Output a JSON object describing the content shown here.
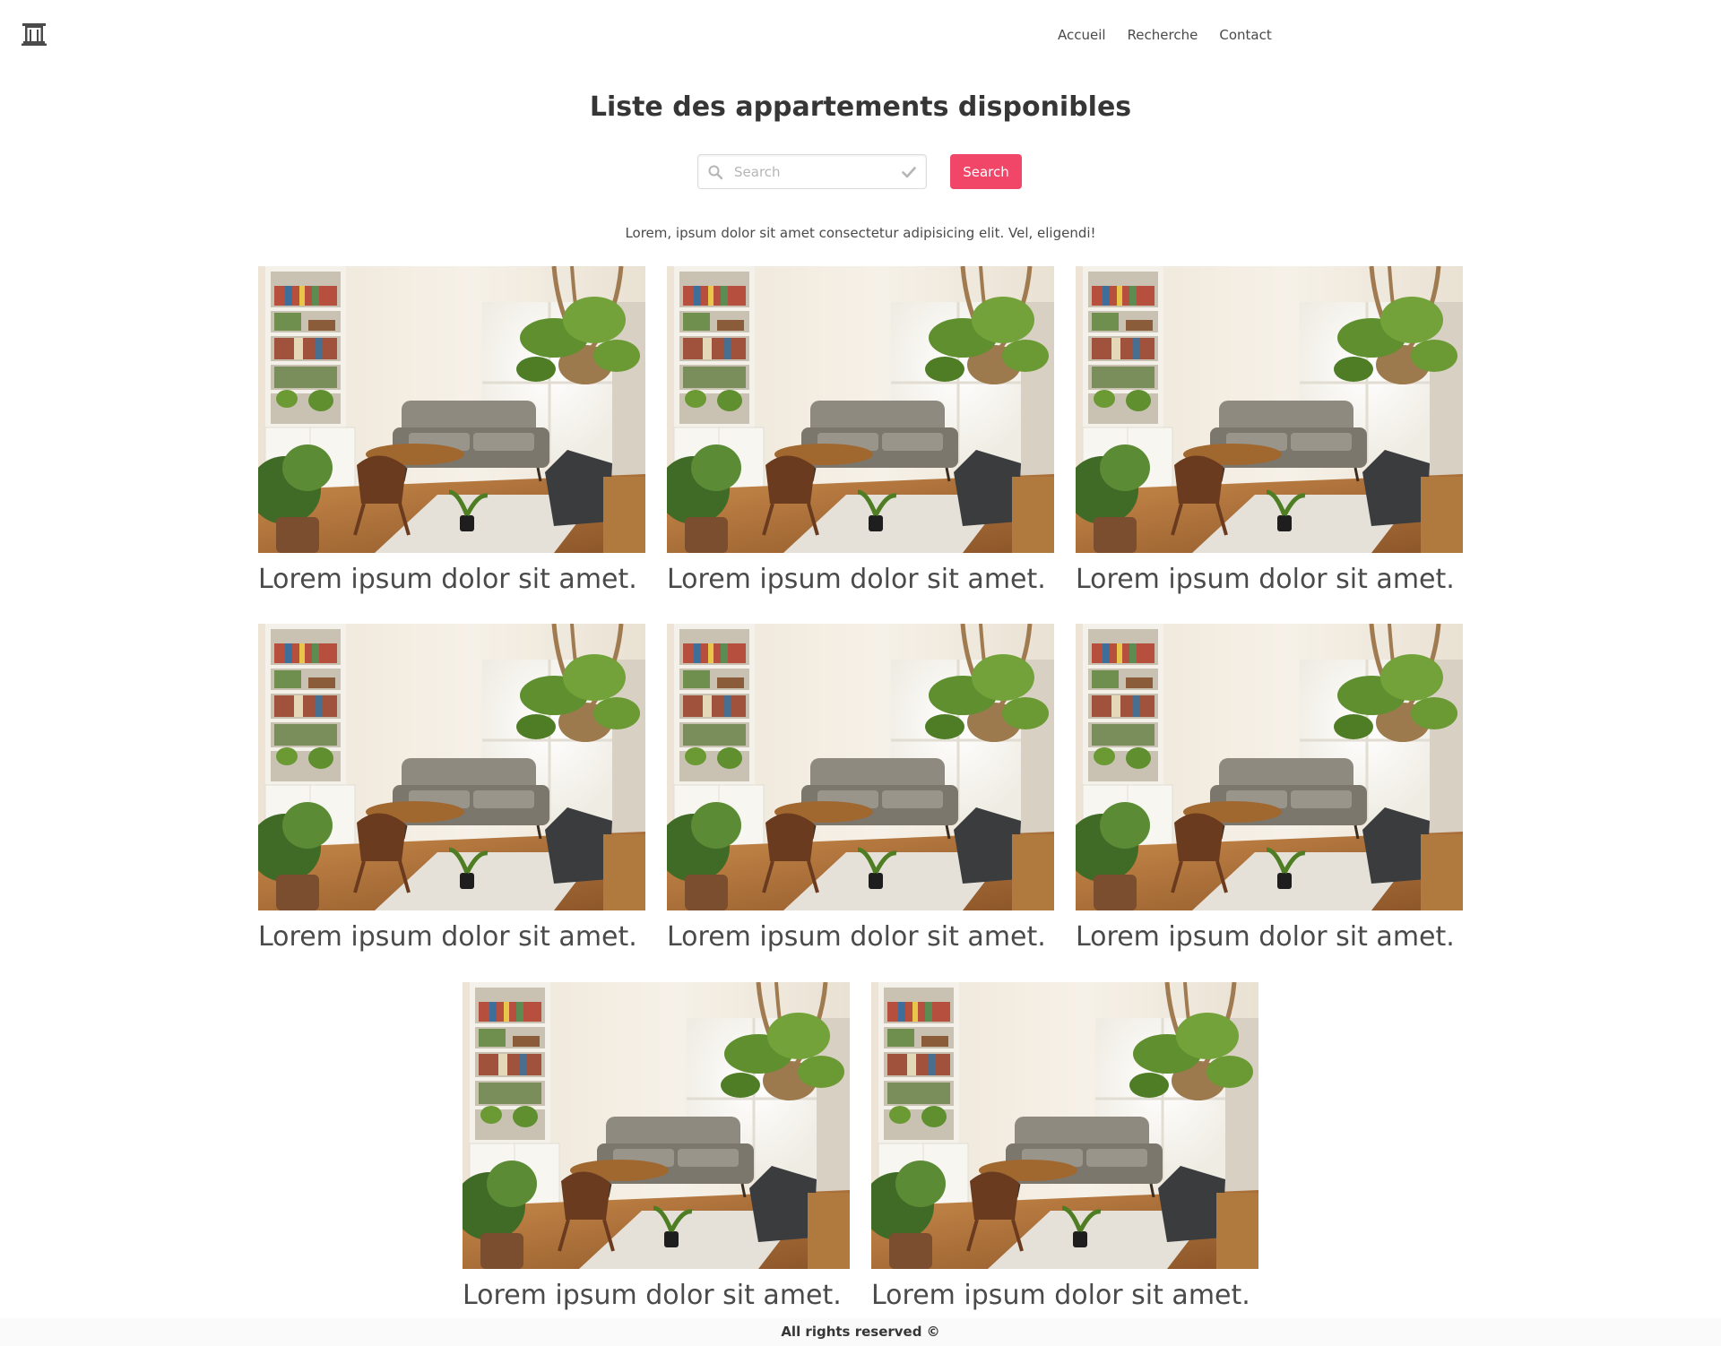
{
  "nav": {
    "brand_icon": "building-icon",
    "links": [
      {
        "label": "Accueil"
      },
      {
        "label": "Recherche"
      },
      {
        "label": "Contact"
      }
    ]
  },
  "page": {
    "title": "Liste des appartements disponibles",
    "intro": "Lorem, ipsum dolor sit amet consectetur adipisicing elit. Vel, eligendi!"
  },
  "search": {
    "placeholder": "Search",
    "value": "",
    "button_label": "Search",
    "left_icon": "search-icon",
    "right_icon": "check-icon"
  },
  "listings": [
    {
      "caption": "Lorem ipsum dolor sit amet.",
      "image": "living-room-photo"
    },
    {
      "caption": "Lorem ipsum dolor sit amet.",
      "image": "living-room-photo"
    },
    {
      "caption": "Lorem ipsum dolor sit amet.",
      "image": "living-room-photo"
    },
    {
      "caption": "Lorem ipsum dolor sit amet.",
      "image": "living-room-photo"
    },
    {
      "caption": "Lorem ipsum dolor sit amet.",
      "image": "living-room-photo"
    },
    {
      "caption": "Lorem ipsum dolor sit amet.",
      "image": "living-room-photo"
    },
    {
      "caption": "Lorem ipsum dolor sit amet.",
      "image": "living-room-photo"
    },
    {
      "caption": "Lorem ipsum dolor sit amet.",
      "image": "living-room-photo"
    }
  ],
  "footer": {
    "text": "All rights reserved ©"
  },
  "colors": {
    "accent": "#f14668",
    "text": "#363636",
    "footer_bg": "#fafafa"
  }
}
